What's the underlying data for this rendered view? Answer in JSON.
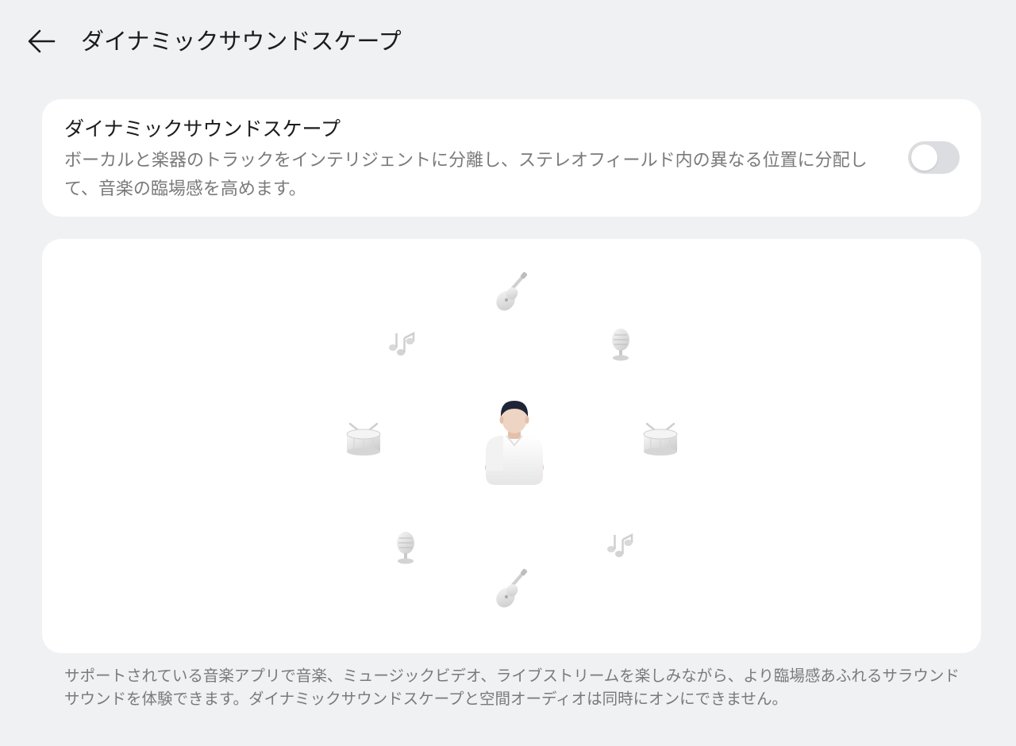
{
  "header": {
    "back_icon": "arrow-left-icon",
    "title": "ダイナミックサウンドスケープ"
  },
  "setting": {
    "title": "ダイナミックサウンドスケープ",
    "description": "ボーカルと楽器のトラックをインテリジェントに分離し、ステレオフィールド内の異なる位置に分配して、音楽の臨場感を高めます。",
    "toggle_state": "off"
  },
  "illustration": {
    "center": "listener-figure",
    "instruments": [
      "guitar-icon",
      "microphone-icon",
      "drum-icon",
      "music-notes-icon",
      "guitar-icon",
      "microphone-icon",
      "drum-icon",
      "music-notes-icon"
    ]
  },
  "footnote": "サポートされている音楽アプリで音楽、ミュージックビデオ、ライブストリームを楽しみながら、より臨場感あふれるサラウンドサウンドを体験できます。ダイナミックサウンドスケープと空間オーディオは同時にオンにできません。",
  "colors": {
    "background": "#f0f1f3",
    "card": "#ffffff",
    "toggle_off": "#dcdde0",
    "secondary_text": "#7a7a7a",
    "hair": "#1d2537"
  }
}
